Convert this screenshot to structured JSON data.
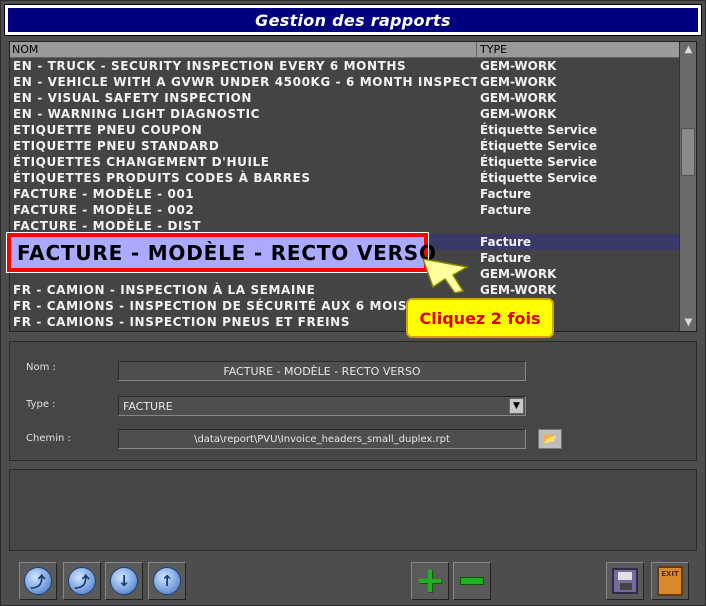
{
  "window": {
    "title": "Gestion des rapports"
  },
  "list": {
    "headers": {
      "name": "NOM",
      "type": "TYPE"
    },
    "rows": [
      {
        "name": "EN - TRUCK - SECURITY INSPECTION EVERY 6 MONTHS",
        "type": "GEM-WORK"
      },
      {
        "name": "EN - VEHICLE WITH A GVWR UNDER 4500KG - 6 MONTH INSPECT",
        "type": "GEM-WORK"
      },
      {
        "name": "EN - VISUAL SAFETY INSPECTION",
        "type": "GEM-WORK"
      },
      {
        "name": "EN - WARNING LIGHT DIAGNOSTIC",
        "type": "GEM-WORK"
      },
      {
        "name": "ETIQUETTE PNEU COUPON",
        "type": "Étiquette Service"
      },
      {
        "name": "ETIQUETTE PNEU STANDARD",
        "type": "Étiquette Service"
      },
      {
        "name": "ÉTIQUETTES CHANGEMENT D'HUILE",
        "type": "Étiquette Service"
      },
      {
        "name": "ÉTIQUETTES PRODUITS CODES À BARRES",
        "type": "Étiquette Service"
      },
      {
        "name": "FACTURE - MODÈLE - 001",
        "type": "Facture"
      },
      {
        "name": "FACTURE - MODÈLE - 002",
        "type": "Facture"
      },
      {
        "name": "FACTURE - MODÈLE - DIST",
        "type": ""
      },
      {
        "name": "",
        "type": "Facture"
      },
      {
        "name": "",
        "type": "Facture"
      },
      {
        "name": "",
        "type": "GEM-WORK"
      },
      {
        "name": "FR - CAMION - INSPECTION À LA SEMAINE",
        "type": "GEM-WORK"
      },
      {
        "name": "FR - CAMIONS - INSPECTION DE SÉCURITÉ AUX 6 MOIS",
        "type": ""
      },
      {
        "name": "FR - CAMIONS - INSPECTION PNEUS ET FREINS",
        "type": ""
      }
    ],
    "selected_index": 11
  },
  "highlight": {
    "text": "FACTURE - MODÈLE - RECTO VERSO"
  },
  "callout": {
    "text": "Cliquez 2 fois"
  },
  "details": {
    "nom_label": "Nom :",
    "nom_value": "FACTURE - MODÈLE - RECTO VERSO",
    "type_label": "Type :",
    "type_value": "FACTURE",
    "chemin_label": "Chemin :",
    "chemin_value": "\\data\\report\\PVU\\Invoice_headers_small_duplex.rpt"
  },
  "toolbar": {
    "buttons": [
      "arrow-left-up-icon",
      "arrow-right-up-icon",
      "arrow-down-icon",
      "arrow-up-icon",
      "plus-icon",
      "minus-icon",
      "save-icon",
      "exit-icon"
    ],
    "exit_label": "EXIT"
  },
  "colors": {
    "title_bg": "#000080",
    "highlight_bg": "#aaaaff",
    "highlight_border": "#ff0000",
    "callout_bg": "#ffff00",
    "callout_text": "#e00000",
    "action_green": "#22b022"
  }
}
